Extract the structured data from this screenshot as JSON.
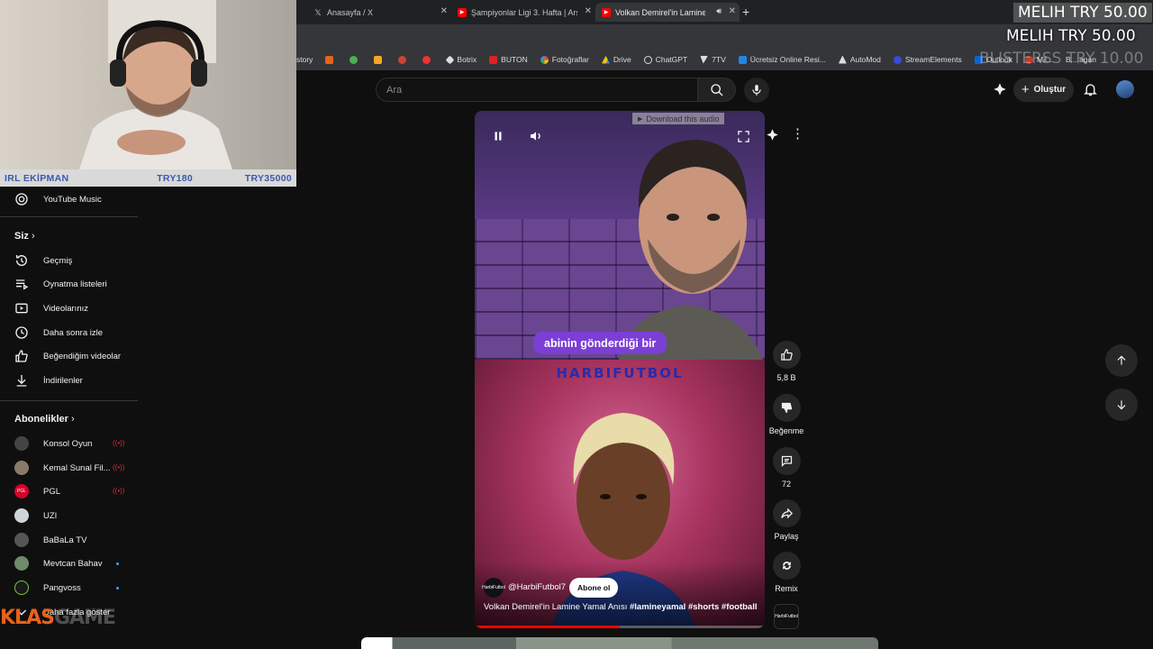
{
  "browser": {
    "tabs": [
      {
        "label": "Anasayfa / X",
        "icon": "x-icon"
      },
      {
        "label": "Şampiyonlar Ligi 3. Hafta | Arse",
        "icon": "youtube-icon"
      },
      {
        "label": "Volkan Demirel'in Lamine Y",
        "icon": "youtube-icon",
        "active": true
      }
    ],
    "bookmarks": [
      "story",
      "Botrix",
      "BUTON",
      "Fotoğraflar",
      "Drive",
      "ChatGPT",
      "7TV",
      "Ücretsiz Online Resi...",
      "AutoMod",
      "StreamElements",
      "Outlook",
      "Mil...",
      "B... agan"
    ]
  },
  "stream_overlay": {
    "irl_label": "IRL EKİPMAN",
    "irl_price1": "TRY180",
    "irl_price2": "TRY35000",
    "donation1": "MELIH  TRY 50.00",
    "donation2": "MELIH  TRY 50.00",
    "donation3": "BLISTERSS  TRY 10.00",
    "klas_logo": "KLAS",
    "klas_logo2": "GAME"
  },
  "masthead": {
    "search_placeholder": "Ara",
    "create_label": "Oluştur"
  },
  "sidebar": {
    "music": "YouTube Music",
    "you_header": "Siz",
    "you_items": [
      "Geçmiş",
      "Oynatma listeleri",
      "Videolarınız",
      "Daha sonra izle",
      "Beğendiğim videolar",
      "İndirilenler"
    ],
    "subs_header": "Abonelikler",
    "subs": [
      {
        "name": "Konsol Oyun",
        "status": "live"
      },
      {
        "name": "Kemal Sunal Fil...",
        "status": "live"
      },
      {
        "name": "PGL",
        "status": "live"
      },
      {
        "name": "UZI",
        "status": ""
      },
      {
        "name": "BaBaLa TV",
        "status": ""
      },
      {
        "name": "Mevtcan Bahav",
        "status": "new"
      },
      {
        "name": "Pangvoss",
        "status": "new"
      }
    ],
    "show_more": "Daha fazla göster"
  },
  "video": {
    "caption": "abinin gönderdiği bir",
    "brand_text": "HARBIFUTBOL",
    "download_banner": "Download this audio",
    "channel": "@HarbiFutbol7",
    "channel_avatar_text": "HarbiFutbol",
    "subscribe": "Abone ol",
    "title": "Volkan Demirel'in Lamine Yamal Anısı",
    "hashtags": "#lamineyamal #shorts #football",
    "progress": 0.5
  },
  "actions": {
    "likes": "5,8 B",
    "dislike": "Beğenme",
    "comments": "72",
    "share": "Paylaş",
    "remix": "Remix"
  },
  "colors": {
    "background": "#0f0f0f",
    "caption_bg": "#7b3fd6",
    "irl_text": "#3d5aa8",
    "klas_orange": "#e8621a"
  }
}
